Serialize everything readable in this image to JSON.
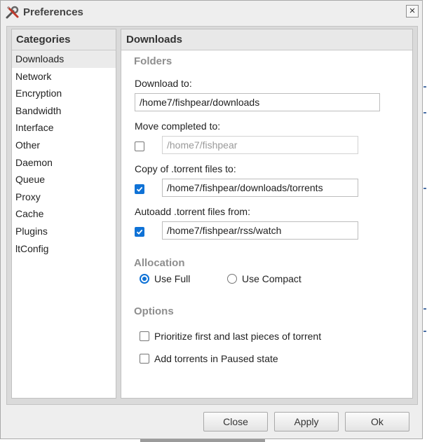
{
  "window": {
    "title": "Preferences",
    "close_glyph": "×",
    "icon": "tools-icon"
  },
  "categories": {
    "header": "Categories",
    "items": [
      {
        "label": "Downloads",
        "selected": true
      },
      {
        "label": "Network"
      },
      {
        "label": "Encryption"
      },
      {
        "label": "Bandwidth"
      },
      {
        "label": "Interface"
      },
      {
        "label": "Other"
      },
      {
        "label": "Daemon"
      },
      {
        "label": "Queue"
      },
      {
        "label": "Proxy"
      },
      {
        "label": "Cache"
      },
      {
        "label": "Plugins"
      },
      {
        "label": "ltConfig"
      }
    ]
  },
  "downloads": {
    "header": "Downloads",
    "folders": {
      "title": "Folders",
      "download_to": {
        "label": "Download to:",
        "value": "/home7/fishpear/downloads"
      },
      "move_completed": {
        "label": "Move completed to:",
        "checked": false,
        "value": "/home7/fishpear"
      },
      "copy_torrent": {
        "label": "Copy of .torrent files to:",
        "checked": true,
        "value": "/home7/fishpear/downloads/torrents"
      },
      "autoadd": {
        "label": "Autoadd .torrent files from:",
        "checked": true,
        "value": "/home7/fishpear/rss/watch"
      }
    },
    "allocation": {
      "title": "Allocation",
      "use_full": {
        "label": "Use Full",
        "selected": true
      },
      "use_compact": {
        "label": "Use Compact",
        "selected": false
      }
    },
    "options": {
      "title": "Options",
      "prioritize": {
        "label": "Prioritize first and last pieces of torrent",
        "checked": false
      },
      "paused": {
        "label": "Add torrents in Paused state",
        "checked": false
      }
    }
  },
  "buttons": {
    "close": "Close",
    "apply": "Apply",
    "ok": "Ok"
  },
  "colors": {
    "accent": "#0f72d6",
    "section_title": "#8e8e8e",
    "window_bg": "#eeeeee"
  }
}
